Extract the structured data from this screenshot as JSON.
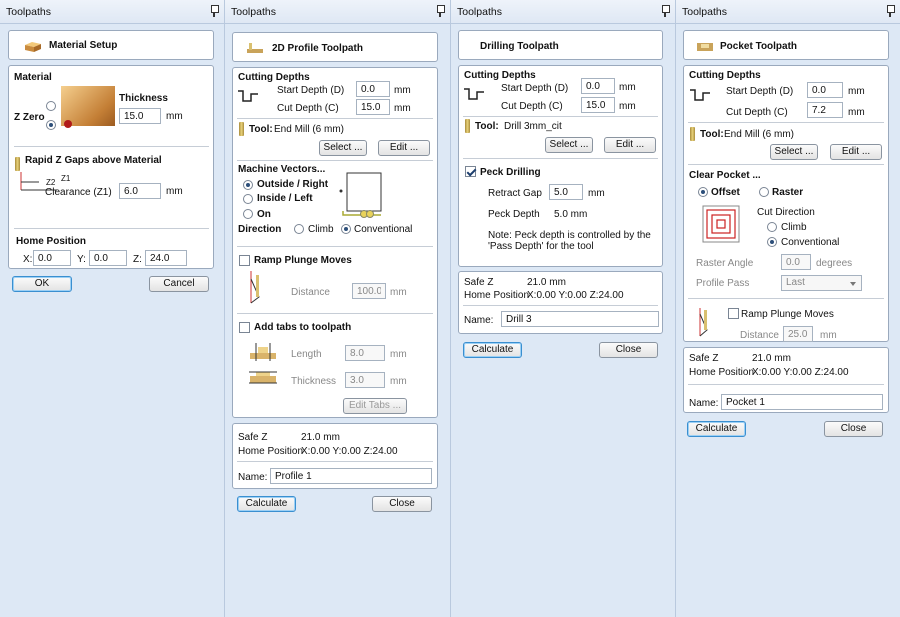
{
  "panes": [
    {
      "title": "Toolpaths",
      "header": "Material Setup",
      "material": {
        "label": "Material",
        "zzero": "Z Zero",
        "thickness_label": "Thickness",
        "thickness": "15.0",
        "unit": "mm"
      },
      "gaps": {
        "label": "Rapid Z Gaps above Material",
        "z1": "Z1",
        "z2": "Z2",
        "clearance_label": "Clearance (Z1)",
        "clearance": "6.0",
        "unit": "mm"
      },
      "home": {
        "label": "Home Position",
        "x_label": "X:",
        "x": "0.0",
        "y_label": "Y:",
        "y": "0.0",
        "z_label": "Z:",
        "z": "24.0"
      },
      "ok": "OK",
      "cancel": "Cancel"
    },
    {
      "title": "Toolpaths",
      "header": "2D Profile Toolpath",
      "depths": {
        "label": "Cutting Depths",
        "start_label": "Start Depth (D)",
        "start": "0.0",
        "cut_label": "Cut Depth (C)",
        "cut": "15.0",
        "unit": "mm"
      },
      "tool": {
        "label": "Tool:",
        "name": "End Mill (6 mm)",
        "select": "Select ...",
        "edit": "Edit ..."
      },
      "vectors": {
        "label": "Machine Vectors...",
        "outside": "Outside / Right",
        "inside": "Inside / Left",
        "on": "On",
        "direction": "Direction",
        "climb": "Climb",
        "conventional": "Conventional"
      },
      "ramp": {
        "label": "Ramp Plunge Moves",
        "distance_label": "Distance",
        "distance": "100.0",
        "unit": "mm"
      },
      "tabs": {
        "label": "Add tabs to toolpath",
        "length_label": "Length",
        "length": "8.0",
        "thickness_label": "Thickness",
        "thickness": "3.0",
        "unit": "mm",
        "edit": "Edit Tabs ..."
      },
      "safe": {
        "safe_label": "Safe Z",
        "safe": "21.0 mm",
        "home_label": "Home Position",
        "home": "X:0.00 Y:0.00 Z:24.00"
      },
      "name_label": "Name:",
      "name": "Profile 1",
      "calculate": "Calculate",
      "close": "Close"
    },
    {
      "title": "Toolpaths",
      "header": "Drilling Toolpath",
      "depths": {
        "label": "Cutting Depths",
        "start_label": "Start Depth (D)",
        "start": "0.0",
        "cut_label": "Cut Depth (C)",
        "cut": "15.0",
        "unit": "mm"
      },
      "tool": {
        "label": "Tool:",
        "name": "Drill 3mm_cit",
        "select": "Select ...",
        "edit": "Edit ..."
      },
      "peck": {
        "label": "Peck Drilling",
        "retract_label": "Retract Gap",
        "retract": "5.0",
        "unit": "mm",
        "depth_label": "Peck Depth",
        "depth": "5.0 mm",
        "note1": "Note: Peck depth is controlled by the",
        "note2": "'Pass Depth' for the tool"
      },
      "safe": {
        "safe_label": "Safe Z",
        "safe": "21.0 mm",
        "home_label": "Home Position",
        "home": "X:0.00 Y:0.00 Z:24.00"
      },
      "name_label": "Name:",
      "name": "Drill 3",
      "calculate": "Calculate",
      "close": "Close"
    },
    {
      "title": "Toolpaths",
      "header": "Pocket Toolpath",
      "depths": {
        "label": "Cutting Depths",
        "start_label": "Start Depth (D)",
        "start": "0.0",
        "cut_label": "Cut Depth (C)",
        "cut": "7.2",
        "unit": "mm"
      },
      "tool": {
        "label": "Tool:",
        "name": "End Mill (6 mm)",
        "select": "Select ...",
        "edit": "Edit ..."
      },
      "clear": {
        "label": "Clear Pocket ...",
        "offset": "Offset",
        "raster": "Raster",
        "cut_dir": "Cut Direction",
        "climb": "Climb",
        "conventional": "Conventional",
        "angle_label": "Raster Angle",
        "angle": "0.0",
        "angle_unit": "degrees",
        "pass_label": "Profile Pass",
        "pass": "Last"
      },
      "ramp": {
        "label": "Ramp Plunge Moves",
        "distance_label": "Distance",
        "distance": "25.0",
        "unit": "mm"
      },
      "safe": {
        "safe_label": "Safe Z",
        "safe": "21.0 mm",
        "home_label": "Home Position",
        "home": "X:0.00 Y:0.00 Z:24.00"
      },
      "name_label": "Name:",
      "name": "Pocket 1",
      "calculate": "Calculate",
      "close": "Close"
    }
  ],
  "colors": {
    "background": "#dde8f5",
    "panel": "#ffffff",
    "border": "#9aa9bd"
  }
}
